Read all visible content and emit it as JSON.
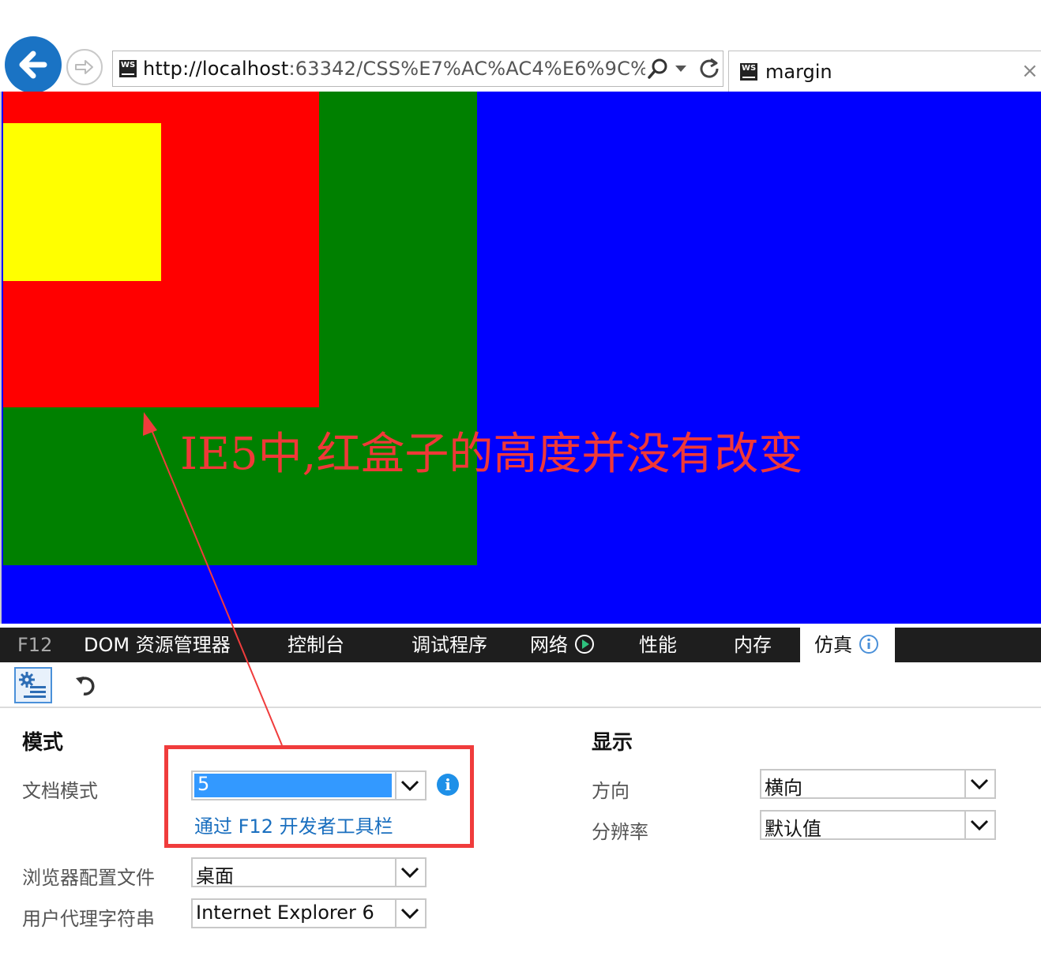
{
  "browser": {
    "url_host": "http://localhost",
    "url_rest": ":63342/CSS%E7%AC%AC4%E6%9C%9F%",
    "tab_title": "margin",
    "tab_close": "×",
    "icons": [
      "back-arrow-icon",
      "forward-arrow-icon",
      "webstorm-icon",
      "search-icon",
      "dropdown-icon",
      "refresh-icon",
      "close-icon"
    ]
  },
  "page": {
    "colors": {
      "outer": "#0000ff",
      "green": "#008000",
      "red": "#ff0000",
      "yellow": "#ffff00"
    },
    "annotation": "IE5中,红盒子的高度并没有改变"
  },
  "devtools": {
    "tabs": [
      {
        "label": "F12"
      },
      {
        "label": "DOM 资源管理器"
      },
      {
        "label": "控制台"
      },
      {
        "label": "调试程序"
      },
      {
        "label": "网络"
      },
      {
        "label": "性能"
      },
      {
        "label": "内存"
      },
      {
        "label": "仿真"
      }
    ],
    "mode": {
      "heading": "模式",
      "doc_mode_label": "文档模式",
      "doc_mode_value": "5",
      "doc_mode_link": "通过 F12 开发者工具栏",
      "profile_label": "浏览器配置文件",
      "profile_value": "桌面",
      "ua_label": "用户代理字符串",
      "ua_value": "Internet Explorer 6"
    },
    "display": {
      "heading": "显示",
      "orientation_label": "方向",
      "orientation_value": "横向",
      "resolution_label": "分辨率",
      "resolution_value": "默认值"
    }
  }
}
